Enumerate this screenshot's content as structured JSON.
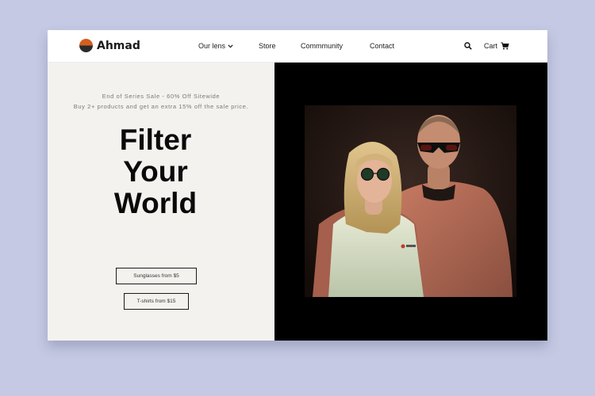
{
  "brand": {
    "name": "Ahmad",
    "logo_colors": [
      "#d45f1f",
      "#2b2b2b"
    ]
  },
  "nav": {
    "items": [
      {
        "label": "Our lens",
        "has_dropdown": true
      },
      {
        "label": "Store"
      },
      {
        "label": "Commmunity"
      },
      {
        "label": "Contact"
      }
    ],
    "search_icon": "search-icon",
    "cart_label": "Cart",
    "cart_icon": "cart-icon"
  },
  "hero": {
    "promo_line1": "End of Series Sale - 60% Off Sitewide",
    "promo_line2": "Buy 2+ products and get an extra 15% off the sale price.",
    "headline": [
      "Filter",
      "Your",
      "World"
    ],
    "buttons": [
      {
        "label": "Sunglasses from $5"
      },
      {
        "label": "T-shirts from $15"
      }
    ],
    "image": "couple-wearing-sunglasses-photo"
  },
  "colors": {
    "background": "#c5c9e3",
    "accent": "#d45f1f",
    "hero_left": "#f3f2ee",
    "hero_right": "#000000"
  }
}
